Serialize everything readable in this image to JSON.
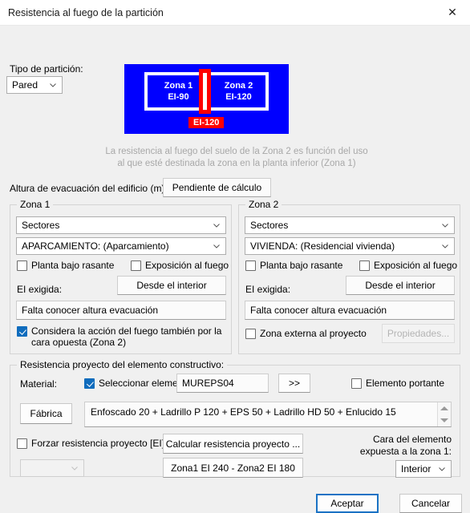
{
  "window": {
    "title": "Resistencia al fuego de la partición",
    "close_icon": "close-icon"
  },
  "partition": {
    "type_label": "Tipo de partición:",
    "type_value": "Pared"
  },
  "diagram": {
    "zone1_name": "Zona 1",
    "zone1_ei": "EI-90",
    "zone2_name": "Zona 2",
    "zone2_ei": "EI-120",
    "divider_label": "EI-120",
    "background_color": "#0000FF",
    "divider_color": "#FF0000",
    "frame_color": "#FFFFFF"
  },
  "help_text": "La resistencia al fuego del suelo de la Zona 2 es función del uso\nal que esté destinada la zona en la planta inferior (Zona 1)",
  "evacuation": {
    "label": "Altura de evacuación del edificio (m):",
    "value": "Pendiente de cálculo"
  },
  "zone1": {
    "title": "Zona 1",
    "combo_level": "Sectores",
    "combo_use": "APARCAMIENTO: (Aparcamiento)",
    "check_underground": "Planta bajo rasante",
    "check_underground_on": false,
    "check_exposure": "Exposición al fuego",
    "check_exposure_on": false,
    "ei_label": "EI exigida:",
    "ei_value": "Desde el interior",
    "status": "Falta conocer altura evacuación",
    "check_opposite": "Considera la acción del fuego también por la cara opuesta (Zona 2)",
    "check_opposite_on": true
  },
  "zone2": {
    "title": "Zona 2",
    "combo_level": "Sectores",
    "combo_use": "VIVIENDA: (Residencial vivienda)",
    "check_underground": "Planta bajo rasante",
    "check_underground_on": false,
    "check_exposure": "Exposición al fuego",
    "check_exposure_on": false,
    "ei_label": "EI exigida:",
    "ei_value": "Desde el interior",
    "status": "Falta conocer altura evacuación",
    "check_external": "Zona externa al proyecto",
    "check_external_on": false,
    "properties_button": "Propiedades..."
  },
  "resistance": {
    "title": "Resistencia proyecto del elemento constructivo:",
    "material_label": "Material:",
    "check_select_element": "Seleccionar elemento",
    "check_select_element_on": true,
    "element_code": "MUREPS04",
    "browse_button": ">>",
    "check_load_bearing": "Elemento portante",
    "check_load_bearing_on": false,
    "fabrica_button": "Fábrica",
    "composition": "Enfoscado 20 + Ladrillo P 120 + EPS 50 + Ladrillo HD 50 + Enlucido 15",
    "check_force": "Forzar resistencia proyecto [EI]:",
    "check_force_on": false,
    "force_combo_value": "",
    "calculate_button": "Calcular resistencia proyecto ...",
    "result_button": "Zona1 EI 240 - Zona2 EI 180",
    "exposed_face_label": "Cara del elemento expuesta a la zona 1:",
    "exposed_face_value": "Interior"
  },
  "footer": {
    "accept": "Aceptar",
    "cancel": "Cancelar"
  }
}
